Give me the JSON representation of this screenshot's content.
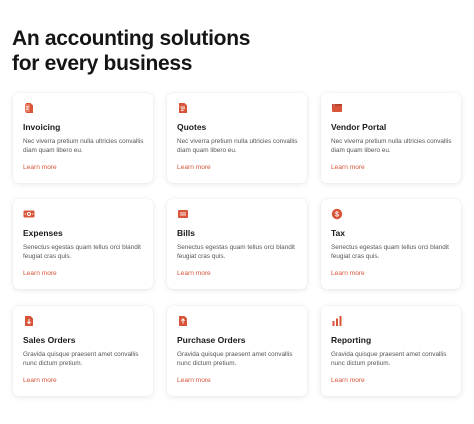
{
  "headline": {
    "line1": "An accounting solutions",
    "line2": "for every business"
  },
  "accent_color": "#d8553a",
  "cards": [
    {
      "title": "Invoicing",
      "description": "Nec viverra pretium nulla ultricies convallis diam quam libero eu.",
      "link": "Learn more",
      "icon": "invoice-icon"
    },
    {
      "title": "Quotes",
      "description": "Nec viverra pretium nulla ultricies convallis diam quam libero eu.",
      "link": "Learn more",
      "icon": "quote-icon"
    },
    {
      "title": "Vendor Portal",
      "description": "Nec viverra pretium nulla ultricies convallis diam quam libero eu.",
      "link": "Learn more",
      "icon": "portal-icon"
    },
    {
      "title": "Expenses",
      "description": "Senectus egestas quam tellus orci blandit feugiat cras quis.",
      "link": "Learn more",
      "icon": "banknote-icon"
    },
    {
      "title": "Bills",
      "description": "Senectus egestas quam tellus orci blandit feugiat cras quis.",
      "link": "Learn more",
      "icon": "bill-icon"
    },
    {
      "title": "Tax",
      "description": "Senectus egestas quam tellus orci blandit feugiat cras quis.",
      "link": "Learn more",
      "icon": "dollar-coin-icon"
    },
    {
      "title": "Sales Orders",
      "description": "Gravida quisque praesent amet convallis nunc dictum pretium.",
      "link": "Learn more",
      "icon": "sales-order-icon"
    },
    {
      "title": "Purchase Orders",
      "description": "Gravida quisque praesent amet convallis nunc dictum pretium.",
      "link": "Learn more",
      "icon": "purchase-order-icon"
    },
    {
      "title": "Reporting",
      "description": "Gravida quisque praesent amet convallis nunc dictum pretium.",
      "link": "Learn more",
      "icon": "bar-chart-icon"
    }
  ]
}
